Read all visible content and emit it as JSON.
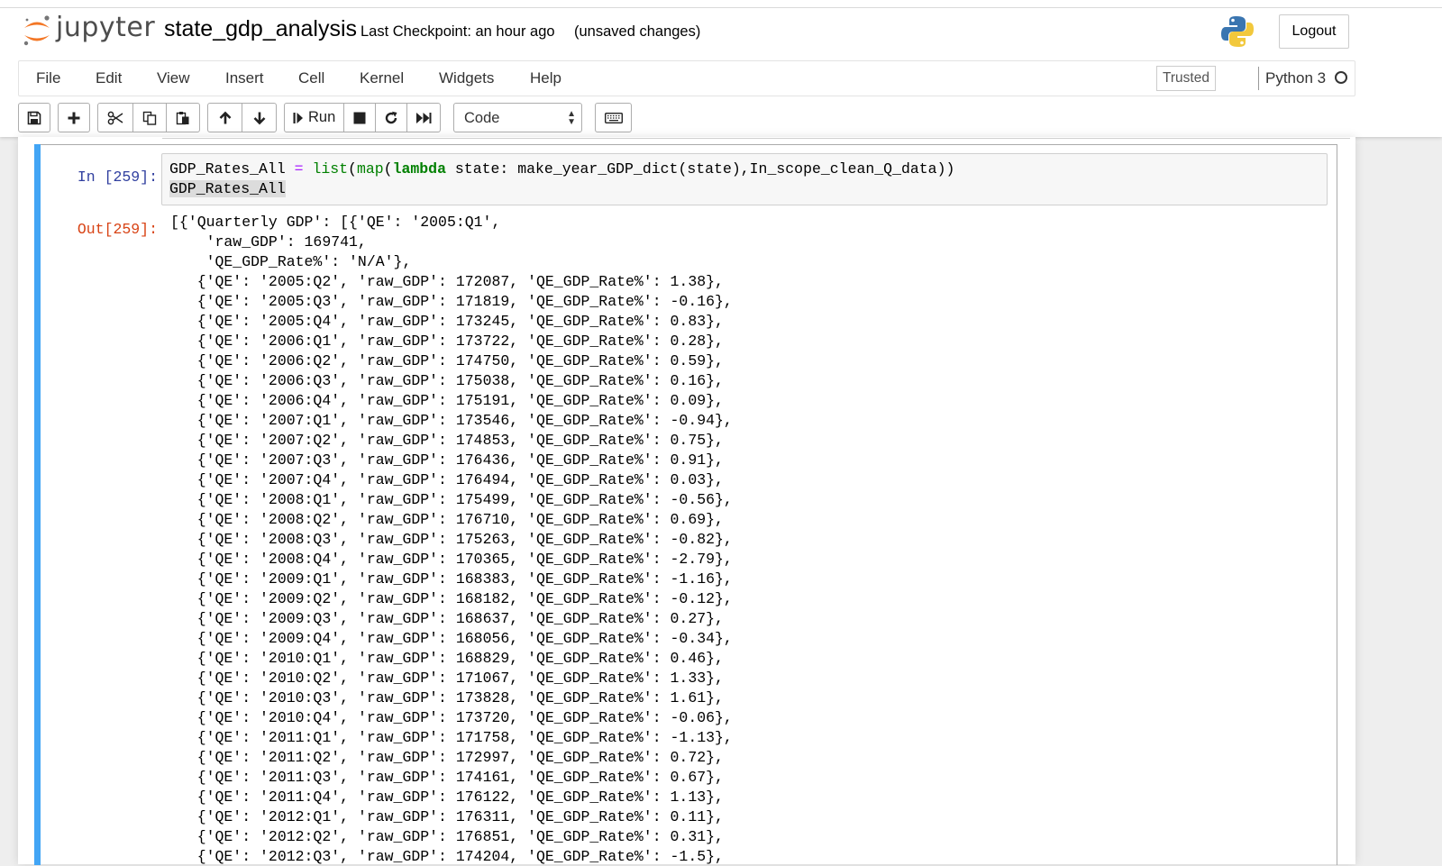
{
  "header": {
    "logo_text": "jupyter",
    "notebook_title": "state_gdp_analysis",
    "checkpoint": "Last Checkpoint: an hour ago",
    "save_status": "(unsaved changes)",
    "logout_label": "Logout"
  },
  "menubar": {
    "items": [
      "File",
      "Edit",
      "View",
      "Insert",
      "Cell",
      "Kernel",
      "Widgets",
      "Help"
    ],
    "trusted_label": "Trusted",
    "kernel_name": "Python 3"
  },
  "toolbar": {
    "icons": [
      "save-icon",
      "plus-icon",
      "cut-icon",
      "copy-icon",
      "paste-icon",
      "arrow-up-icon",
      "arrow-down-icon",
      "run-icon",
      "stop-icon",
      "restart-icon",
      "fast-forward-icon",
      "keyboard-icon"
    ],
    "run_label": "Run",
    "cell_type": "Code"
  },
  "cell": {
    "in_prompt": "In [259]:",
    "out_prompt": "Out[259]:",
    "code": {
      "l1_var": "GDP_Rates_All ",
      "l1_op": "=",
      "l1_sp": " ",
      "l1_list": "list",
      "l1_p1": "(",
      "l1_map": "map",
      "l1_p2": "(",
      "l1_lambda": "lambda",
      "l1_rest": " state: make_year_GDP_dict(state),In_scope_clean_Q_data))",
      "l2": "GDP_Rates_All"
    },
    "output_head": [
      "[{'Quarterly GDP': [{'QE': '2005:Q1',",
      "    'raw_GDP': 169741,",
      "    'QE_GDP_Rate%': 'N/A'},"
    ],
    "output_rows": [
      {
        "qe": "2005:Q2",
        "raw_gdp": "172087",
        "rate": "1.38"
      },
      {
        "qe": "2005:Q3",
        "raw_gdp": "171819",
        "rate": "-0.16"
      },
      {
        "qe": "2005:Q4",
        "raw_gdp": "173245",
        "rate": "0.83"
      },
      {
        "qe": "2006:Q1",
        "raw_gdp": "173722",
        "rate": "0.28"
      },
      {
        "qe": "2006:Q2",
        "raw_gdp": "174750",
        "rate": "0.59"
      },
      {
        "qe": "2006:Q3",
        "raw_gdp": "175038",
        "rate": "0.16"
      },
      {
        "qe": "2006:Q4",
        "raw_gdp": "175191",
        "rate": "0.09"
      },
      {
        "qe": "2007:Q1",
        "raw_gdp": "173546",
        "rate": "-0.94"
      },
      {
        "qe": "2007:Q2",
        "raw_gdp": "174853",
        "rate": "0.75"
      },
      {
        "qe": "2007:Q3",
        "raw_gdp": "176436",
        "rate": "0.91"
      },
      {
        "qe": "2007:Q4",
        "raw_gdp": "176494",
        "rate": "0.03"
      },
      {
        "qe": "2008:Q1",
        "raw_gdp": "175499",
        "rate": "-0.56"
      },
      {
        "qe": "2008:Q2",
        "raw_gdp": "176710",
        "rate": "0.69"
      },
      {
        "qe": "2008:Q3",
        "raw_gdp": "175263",
        "rate": "-0.82"
      },
      {
        "qe": "2008:Q4",
        "raw_gdp": "170365",
        "rate": "-2.79"
      },
      {
        "qe": "2009:Q1",
        "raw_gdp": "168383",
        "rate": "-1.16"
      },
      {
        "qe": "2009:Q2",
        "raw_gdp": "168182",
        "rate": "-0.12"
      },
      {
        "qe": "2009:Q3",
        "raw_gdp": "168637",
        "rate": "0.27"
      },
      {
        "qe": "2009:Q4",
        "raw_gdp": "168056",
        "rate": "-0.34"
      },
      {
        "qe": "2010:Q1",
        "raw_gdp": "168829",
        "rate": "0.46"
      },
      {
        "qe": "2010:Q2",
        "raw_gdp": "171067",
        "rate": "1.33"
      },
      {
        "qe": "2010:Q3",
        "raw_gdp": "173828",
        "rate": "1.61"
      },
      {
        "qe": "2010:Q4",
        "raw_gdp": "173720",
        "rate": "-0.06"
      },
      {
        "qe": "2011:Q1",
        "raw_gdp": "171758",
        "rate": "-1.13"
      },
      {
        "qe": "2011:Q2",
        "raw_gdp": "172997",
        "rate": "0.72"
      },
      {
        "qe": "2011:Q3",
        "raw_gdp": "174161",
        "rate": "0.67"
      },
      {
        "qe": "2011:Q4",
        "raw_gdp": "176122",
        "rate": "1.13"
      },
      {
        "qe": "2012:Q1",
        "raw_gdp": "176311",
        "rate": "0.11"
      },
      {
        "qe": "2012:Q2",
        "raw_gdp": "176851",
        "rate": "0.31"
      },
      {
        "qe": "2012:Q3",
        "raw_gdp": "174204",
        "rate": "-1.5"
      }
    ]
  },
  "colors": {
    "in_prompt": "#303f9f",
    "out_prompt": "#d84315",
    "selected_cell_bar": "#42a5f5",
    "logo_orange": "#f37726"
  }
}
